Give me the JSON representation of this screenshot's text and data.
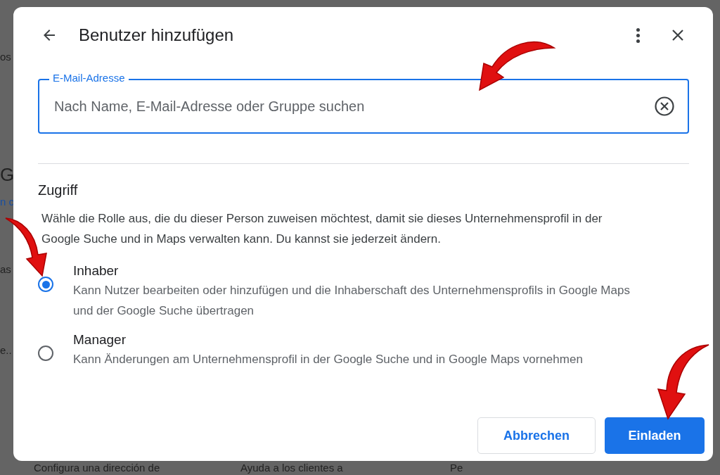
{
  "background": {
    "fragments": [
      {
        "text": "os",
        "kind": "plain"
      },
      {
        "text": "G",
        "kind": "heading"
      },
      {
        "text": "n c",
        "kind": "link"
      },
      {
        "text": "as",
        "kind": "plain"
      },
      {
        "text": "e..",
        "kind": "plain"
      },
      {
        "text": "Configura una dirección de",
        "kind": "plain"
      },
      {
        "text": "Ayuda a los clientes a",
        "kind": "plain"
      },
      {
        "text": "Pe",
        "kind": "plain"
      }
    ]
  },
  "dialog": {
    "title": "Benutzer hinzufügen",
    "email_field": {
      "label": "E-Mail-Adresse",
      "placeholder": "Nach Name, E-Mail-Adresse oder Gruppe suchen"
    },
    "access": {
      "heading": "Zugriff",
      "description": "Wähle die Rolle aus, die du dieser Person zuweisen möchtest, damit sie dieses Unternehmensprofil in der Google Suche und in Maps verwalten kann. Du kannst sie jederzeit ändern.",
      "roles": [
        {
          "label": "Inhaber",
          "description": "Kann Nutzer bearbeiten oder hinzufügen und die Inhaberschaft des Unternehmensprofils in Google Maps und der Google Suche übertragen",
          "selected": true
        },
        {
          "label": "Manager",
          "description": "Kann Änderungen am Unternehmensprofil in der Google Suche und in Google Maps vornehmen",
          "selected": false
        }
      ]
    },
    "buttons": [
      {
        "label": "Abbrechen",
        "kind": "secondary"
      },
      {
        "label": "Einladen",
        "kind": "primary"
      }
    ]
  },
  "annotations": [
    {
      "kind": "arrow"
    },
    {
      "kind": "arrow"
    },
    {
      "kind": "arrow"
    }
  ]
}
